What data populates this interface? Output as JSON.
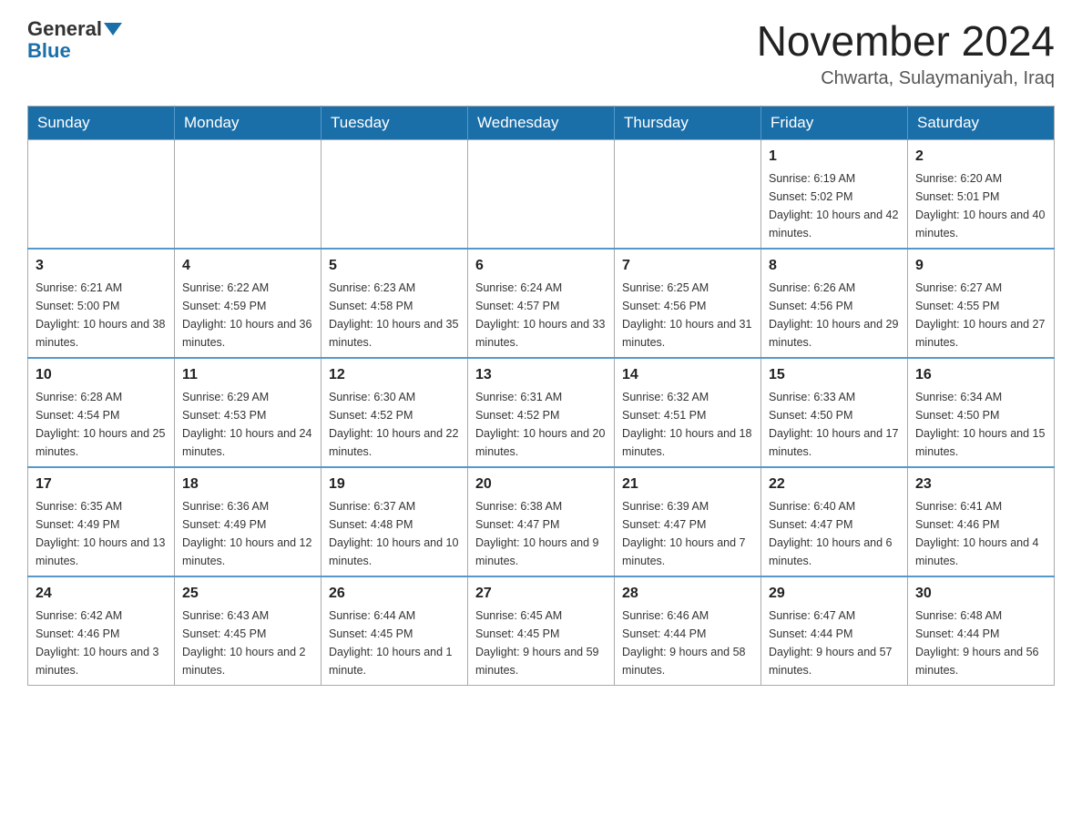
{
  "logo": {
    "general": "General",
    "blue": "Blue"
  },
  "title": "November 2024",
  "location": "Chwarta, Sulaymaniyah, Iraq",
  "days_of_week": [
    "Sunday",
    "Monday",
    "Tuesday",
    "Wednesday",
    "Thursday",
    "Friday",
    "Saturday"
  ],
  "weeks": [
    [
      {
        "day": "",
        "info": ""
      },
      {
        "day": "",
        "info": ""
      },
      {
        "day": "",
        "info": ""
      },
      {
        "day": "",
        "info": ""
      },
      {
        "day": "",
        "info": ""
      },
      {
        "day": "1",
        "info": "Sunrise: 6:19 AM\nSunset: 5:02 PM\nDaylight: 10 hours and 42 minutes."
      },
      {
        "day": "2",
        "info": "Sunrise: 6:20 AM\nSunset: 5:01 PM\nDaylight: 10 hours and 40 minutes."
      }
    ],
    [
      {
        "day": "3",
        "info": "Sunrise: 6:21 AM\nSunset: 5:00 PM\nDaylight: 10 hours and 38 minutes."
      },
      {
        "day": "4",
        "info": "Sunrise: 6:22 AM\nSunset: 4:59 PM\nDaylight: 10 hours and 36 minutes."
      },
      {
        "day": "5",
        "info": "Sunrise: 6:23 AM\nSunset: 4:58 PM\nDaylight: 10 hours and 35 minutes."
      },
      {
        "day": "6",
        "info": "Sunrise: 6:24 AM\nSunset: 4:57 PM\nDaylight: 10 hours and 33 minutes."
      },
      {
        "day": "7",
        "info": "Sunrise: 6:25 AM\nSunset: 4:56 PM\nDaylight: 10 hours and 31 minutes."
      },
      {
        "day": "8",
        "info": "Sunrise: 6:26 AM\nSunset: 4:56 PM\nDaylight: 10 hours and 29 minutes."
      },
      {
        "day": "9",
        "info": "Sunrise: 6:27 AM\nSunset: 4:55 PM\nDaylight: 10 hours and 27 minutes."
      }
    ],
    [
      {
        "day": "10",
        "info": "Sunrise: 6:28 AM\nSunset: 4:54 PM\nDaylight: 10 hours and 25 minutes."
      },
      {
        "day": "11",
        "info": "Sunrise: 6:29 AM\nSunset: 4:53 PM\nDaylight: 10 hours and 24 minutes."
      },
      {
        "day": "12",
        "info": "Sunrise: 6:30 AM\nSunset: 4:52 PM\nDaylight: 10 hours and 22 minutes."
      },
      {
        "day": "13",
        "info": "Sunrise: 6:31 AM\nSunset: 4:52 PM\nDaylight: 10 hours and 20 minutes."
      },
      {
        "day": "14",
        "info": "Sunrise: 6:32 AM\nSunset: 4:51 PM\nDaylight: 10 hours and 18 minutes."
      },
      {
        "day": "15",
        "info": "Sunrise: 6:33 AM\nSunset: 4:50 PM\nDaylight: 10 hours and 17 minutes."
      },
      {
        "day": "16",
        "info": "Sunrise: 6:34 AM\nSunset: 4:50 PM\nDaylight: 10 hours and 15 minutes."
      }
    ],
    [
      {
        "day": "17",
        "info": "Sunrise: 6:35 AM\nSunset: 4:49 PM\nDaylight: 10 hours and 13 minutes."
      },
      {
        "day": "18",
        "info": "Sunrise: 6:36 AM\nSunset: 4:49 PM\nDaylight: 10 hours and 12 minutes."
      },
      {
        "day": "19",
        "info": "Sunrise: 6:37 AM\nSunset: 4:48 PM\nDaylight: 10 hours and 10 minutes."
      },
      {
        "day": "20",
        "info": "Sunrise: 6:38 AM\nSunset: 4:47 PM\nDaylight: 10 hours and 9 minutes."
      },
      {
        "day": "21",
        "info": "Sunrise: 6:39 AM\nSunset: 4:47 PM\nDaylight: 10 hours and 7 minutes."
      },
      {
        "day": "22",
        "info": "Sunrise: 6:40 AM\nSunset: 4:47 PM\nDaylight: 10 hours and 6 minutes."
      },
      {
        "day": "23",
        "info": "Sunrise: 6:41 AM\nSunset: 4:46 PM\nDaylight: 10 hours and 4 minutes."
      }
    ],
    [
      {
        "day": "24",
        "info": "Sunrise: 6:42 AM\nSunset: 4:46 PM\nDaylight: 10 hours and 3 minutes."
      },
      {
        "day": "25",
        "info": "Sunrise: 6:43 AM\nSunset: 4:45 PM\nDaylight: 10 hours and 2 minutes."
      },
      {
        "day": "26",
        "info": "Sunrise: 6:44 AM\nSunset: 4:45 PM\nDaylight: 10 hours and 1 minute."
      },
      {
        "day": "27",
        "info": "Sunrise: 6:45 AM\nSunset: 4:45 PM\nDaylight: 9 hours and 59 minutes."
      },
      {
        "day": "28",
        "info": "Sunrise: 6:46 AM\nSunset: 4:44 PM\nDaylight: 9 hours and 58 minutes."
      },
      {
        "day": "29",
        "info": "Sunrise: 6:47 AM\nSunset: 4:44 PM\nDaylight: 9 hours and 57 minutes."
      },
      {
        "day": "30",
        "info": "Sunrise: 6:48 AM\nSunset: 4:44 PM\nDaylight: 9 hours and 56 minutes."
      }
    ]
  ]
}
